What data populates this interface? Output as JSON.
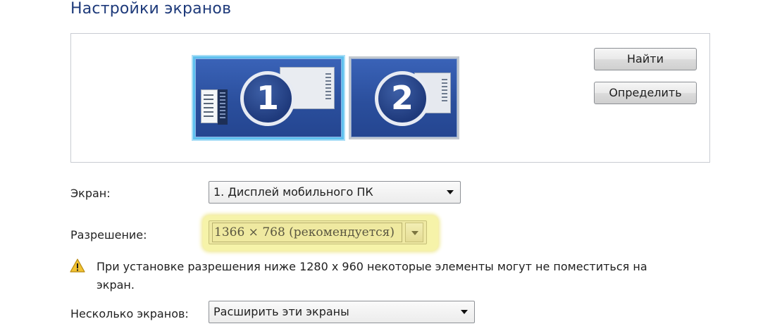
{
  "page": {
    "title": "Настройки экранов"
  },
  "preview": {
    "monitor1_number": "1",
    "monitor2_number": "2",
    "find_button": "Найти",
    "identify_button": "Определить"
  },
  "display": {
    "label": "Экран:",
    "value": "1. Дисплей мобильного ПК"
  },
  "resolution": {
    "label": "Разрешение:",
    "value": "1366 × 768 (рекомендуется)"
  },
  "warning": {
    "icon": "warning-icon",
    "text": "При установке разрешения ниже 1280 x 960 некоторые элементы могут не поместиться на экран."
  },
  "multiple": {
    "label": "Несколько экранов:",
    "value": "Расширить эти экраны"
  },
  "colors": {
    "title": "#1e3a7a",
    "monitor_blue": "#2b4f9d",
    "selected_border": "#5fc1ef",
    "highlight": "#f6f3a9"
  }
}
